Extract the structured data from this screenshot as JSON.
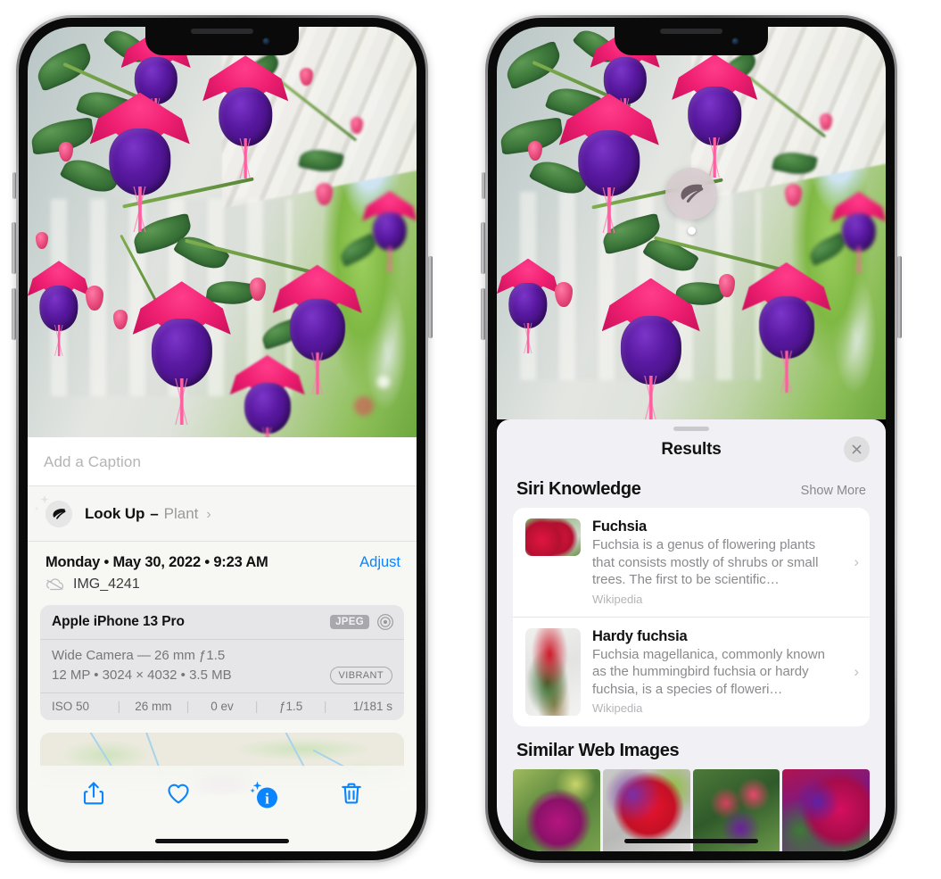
{
  "left_phone": {
    "name": "iphone-photos-info",
    "caption_placeholder": "Add a Caption",
    "lookup": {
      "title": "Look Up",
      "dash": "–",
      "subject": "Plant",
      "chevron": "›",
      "icon": "leaf-icon"
    },
    "meta": {
      "date": "Monday • May 30, 2022 • 9:23 AM",
      "adjust_label": "Adjust",
      "filename": "IMG_4241",
      "cloud_icon": "icloud-slash-icon"
    },
    "exif": {
      "model": "Apple iPhone 13 Pro",
      "format_badge": "JPEG",
      "aperture_icon": "camera-lens-icon",
      "lens_line": "Wide Camera — 26 mm ƒ1.5",
      "spec_line": "12 MP • 3024 × 4032 • 3.5 MB",
      "style_badge": "VIBRANT",
      "stats": [
        "ISO 50",
        "26 mm",
        "0 ev",
        "ƒ1.5",
        "1/181 s"
      ],
      "separator": "|"
    },
    "map": {
      "label": "photo-location-map"
    },
    "toolbar": [
      {
        "name": "share-icon",
        "label": "Share"
      },
      {
        "name": "heart-icon",
        "label": "Favorite"
      },
      {
        "name": "info-sparkle-icon",
        "label": "Info"
      },
      {
        "name": "trash-icon",
        "label": "Delete"
      }
    ]
  },
  "right_phone": {
    "name": "iphone-visual-lookup-results",
    "visual_lookup_badge": {
      "icon": "leaf-icon",
      "label": "visual-look-up-indicator"
    },
    "sheet": {
      "title": "Results",
      "close_icon": "close-icon",
      "grabber": "drag-handle"
    },
    "siri_knowledge": {
      "title": "Siri Knowledge",
      "show_more": "Show More",
      "cards": [
        {
          "title": "Fuchsia",
          "description": "Fuchsia is a genus of flowering plants that consists mostly of shrubs or small trees. The first to be scientific…",
          "source": "Wikipedia",
          "chevron": "›",
          "thumb": "fuchsia-flowers-photo"
        },
        {
          "title": "Hardy fuchsia",
          "description": "Fuchsia magellanica, commonly known as the hummingbird fuchsia or hardy fuchsia, is a species of floweri…",
          "source": "Wikipedia",
          "chevron": "›",
          "thumb": "hardy-fuchsia-branch-photo"
        }
      ]
    },
    "similar_web_images": {
      "title": "Similar Web Images",
      "items": [
        {
          "name": "similar-image-1"
        },
        {
          "name": "similar-image-2"
        },
        {
          "name": "similar-image-3"
        },
        {
          "name": "similar-image-4"
        }
      ]
    }
  },
  "colors": {
    "accent_blue": "#0a84ff",
    "sheet_bg": "#f1f1f5",
    "photos_sheet_bg": "#f7f8f4",
    "exif_card": "#e6e6e8",
    "secondary_text": "#8a8a8e"
  }
}
